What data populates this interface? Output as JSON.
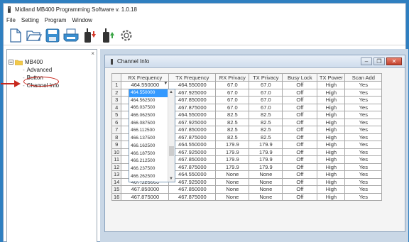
{
  "window": {
    "title": "Midland MB400 Programming Software v. 1.0.18"
  },
  "menu": [
    "File",
    "Setting",
    "Program",
    "Window"
  ],
  "toolbar": [
    "new-icon",
    "open-folder-icon",
    "save-icon",
    "print-icon",
    "read-radio-icon",
    "write-radio-icon",
    "settings-gear-icon"
  ],
  "tree": {
    "close_label": "×",
    "root": "MB400",
    "items": [
      "Advanced",
      "Button",
      "Channel Info"
    ]
  },
  "child": {
    "title": "Channel Info"
  },
  "table": {
    "headers": [
      "RX Frequency",
      "TX Frequency",
      "RX Privacy",
      "TX Privacy",
      "Busy Lock",
      "TX Power",
      "Scan Add"
    ],
    "rows": [
      [
        "1",
        "464.550000",
        "464.550000",
        "67.0",
        "67.0",
        "Off",
        "High",
        "Yes"
      ],
      [
        "2",
        "464.550000",
        "467.925000",
        "67.0",
        "67.0",
        "Off",
        "High",
        "Yes"
      ],
      [
        "3",
        "",
        "467.850000",
        "67.0",
        "67.0",
        "Off",
        "High",
        "Yes"
      ],
      [
        "4",
        "",
        "467.875000",
        "67.0",
        "67.0",
        "Off",
        "High",
        "Yes"
      ],
      [
        "5",
        "",
        "464.550000",
        "82.5",
        "82.5",
        "Off",
        "High",
        "Yes"
      ],
      [
        "6",
        "",
        "467.925000",
        "82.5",
        "82.5",
        "Off",
        "High",
        "Yes"
      ],
      [
        "7",
        "",
        "467.850000",
        "82.5",
        "82.5",
        "Off",
        "High",
        "Yes"
      ],
      [
        "8",
        "",
        "467.875000",
        "82.5",
        "82.5",
        "Off",
        "High",
        "Yes"
      ],
      [
        "9",
        "",
        "464.550000",
        "179.9",
        "179.9",
        "Off",
        "High",
        "Yes"
      ],
      [
        "10",
        "",
        "467.925000",
        "179.9",
        "179.9",
        "Off",
        "High",
        "Yes"
      ],
      [
        "11",
        "",
        "467.850000",
        "179.9",
        "179.9",
        "Off",
        "High",
        "Yes"
      ],
      [
        "12",
        "",
        "467.875000",
        "179.9",
        "179.9",
        "Off",
        "High",
        "Yes"
      ],
      [
        "13",
        "464.550000",
        "464.550000",
        "None",
        "None",
        "Off",
        "High",
        "Yes"
      ],
      [
        "14",
        "467.925000",
        "467.925000",
        "None",
        "None",
        "Off",
        "High",
        "Yes"
      ],
      [
        "15",
        "467.850000",
        "467.850000",
        "None",
        "None",
        "Off",
        "High",
        "Yes"
      ],
      [
        "16",
        "467.875000",
        "467.875000",
        "None",
        "None",
        "Off",
        "High",
        "Yes"
      ]
    ]
  },
  "dropdown": {
    "options": [
      "464.550000",
      "464.562500",
      "466.037500",
      "466.062500",
      "466.087500",
      "466.112500",
      "466.137500",
      "466.162500",
      "466.187500",
      "466.212500",
      "466.237500",
      "466.262500",
      "466.287500"
    ],
    "selected_index": 0
  },
  "colors": {
    "desktop": "#2f7fc0",
    "annotation": "#c8281e",
    "selection": "#3399ff"
  }
}
